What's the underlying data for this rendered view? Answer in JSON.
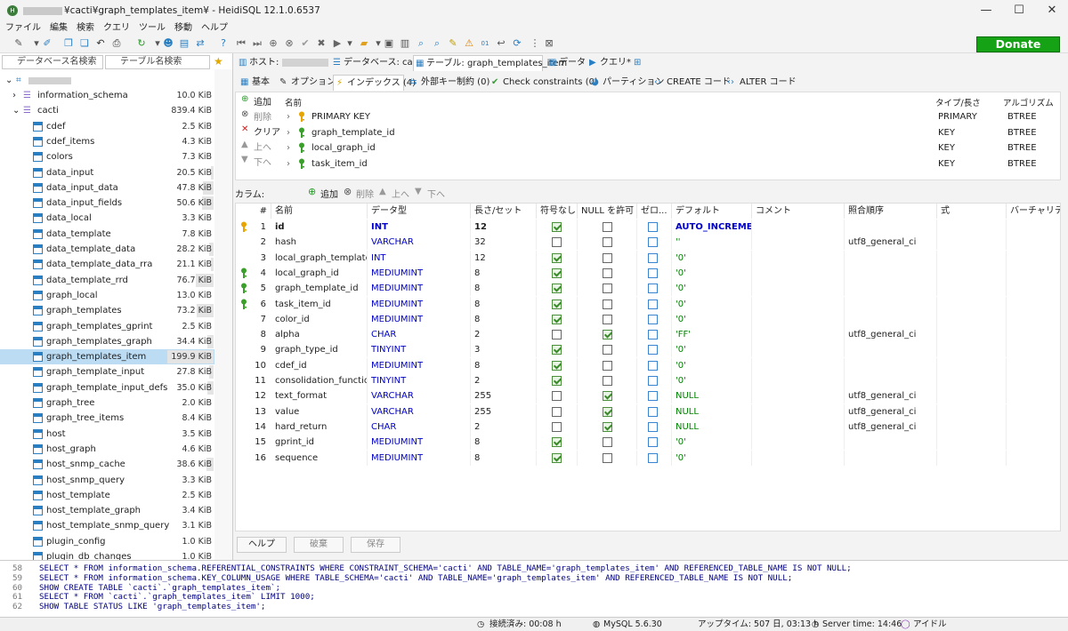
{
  "window": {
    "title": "¥cacti¥graph_templates_item¥ - HeidiSQL 12.1.0.6537",
    "controls": {
      "minimize": "—",
      "maximize": "☐",
      "close": "✕"
    }
  },
  "menu": [
    "ファイル",
    "編集",
    "検索",
    "クエリ",
    "ツール",
    "移動",
    "ヘルプ"
  ],
  "donate": "Donate",
  "left": {
    "db_filter": "データベース名検索",
    "table_filter": "テーブル名検索",
    "tree": [
      {
        "name": "information_schema",
        "size": "10.0 KiB",
        "level": 1,
        "bar": 0
      },
      {
        "name": "cacti",
        "size": "839.4 KiB",
        "level": 1,
        "bar": 0
      },
      {
        "name": "cdef",
        "size": "2.5 KiB",
        "bar": 0
      },
      {
        "name": "cdef_items",
        "size": "4.3 KiB",
        "bar": 0
      },
      {
        "name": "colors",
        "size": "7.3 KiB",
        "bar": 0
      },
      {
        "name": "data_input",
        "size": "20.5 KiB",
        "bar": 0.05
      },
      {
        "name": "data_input_data",
        "size": "47.8 KiB",
        "bar": 0.24
      },
      {
        "name": "data_input_fields",
        "size": "50.6 KiB",
        "bar": 0.25
      },
      {
        "name": "data_local",
        "size": "3.3 KiB",
        "bar": 0
      },
      {
        "name": "data_template",
        "size": "7.8 KiB",
        "bar": 0
      },
      {
        "name": "data_template_data",
        "size": "28.2 KiB",
        "bar": 0.1
      },
      {
        "name": "data_template_data_rra",
        "size": "21.1 KiB",
        "bar": 0.05
      },
      {
        "name": "data_template_rrd",
        "size": "76.7 KiB",
        "bar": 0.38
      },
      {
        "name": "graph_local",
        "size": "13.0 KiB",
        "bar": 0
      },
      {
        "name": "graph_templates",
        "size": "73.2 KiB",
        "bar": 0.36
      },
      {
        "name": "graph_templates_gprint",
        "size": "2.5 KiB",
        "bar": 0
      },
      {
        "name": "graph_templates_graph",
        "size": "34.4 KiB",
        "bar": 0.13
      },
      {
        "name": "graph_templates_item",
        "size": "199.9 KiB",
        "bar": 1,
        "selected": true
      },
      {
        "name": "graph_template_input",
        "size": "27.8 KiB",
        "bar": 0.1
      },
      {
        "name": "graph_template_input_defs",
        "size": "35.0 KiB",
        "bar": 0.13
      },
      {
        "name": "graph_tree",
        "size": "2.0 KiB",
        "bar": 0
      },
      {
        "name": "graph_tree_items",
        "size": "8.4 KiB",
        "bar": 0
      },
      {
        "name": "host",
        "size": "3.5 KiB",
        "bar": 0
      },
      {
        "name": "host_graph",
        "size": "4.6 KiB",
        "bar": 0
      },
      {
        "name": "host_snmp_cache",
        "size": "38.6 KiB",
        "bar": 0.15
      },
      {
        "name": "host_snmp_query",
        "size": "3.3 KiB",
        "bar": 0
      },
      {
        "name": "host_template",
        "size": "2.5 KiB",
        "bar": 0
      },
      {
        "name": "host_template_graph",
        "size": "3.4 KiB",
        "bar": 0
      },
      {
        "name": "host_template_snmp_query",
        "size": "3.1 KiB",
        "bar": 0
      },
      {
        "name": "plugin_config",
        "size": "1.0 KiB",
        "bar": 0
      },
      {
        "name": "plugin_db_changes",
        "size": "1.0 KiB",
        "bar": 0
      }
    ]
  },
  "tabs": {
    "host": "ホスト:",
    "database": "データベース: cacti",
    "table": "テーブル: graph_templates_item",
    "data": "データ",
    "query": "クエリ*"
  },
  "subtabs": [
    "基本",
    "オプション",
    "インデックス (4)",
    "外部キー制約 (0)",
    "Check constraints (0)",
    "パーティション",
    "CREATE コード",
    "ALTER コード"
  ],
  "index": {
    "buttons": {
      "add": "追加",
      "remove": "削除",
      "clear": "クリア",
      "up": "上へ",
      "down": "下へ"
    },
    "headers": {
      "name": "名前",
      "type": "タイプ/長さ",
      "algo": "アルゴリズム"
    },
    "rows": [
      {
        "name": "PRIMARY KEY",
        "type": "PRIMARY",
        "algo": "BTREE",
        "key": "primary"
      },
      {
        "name": "graph_template_id",
        "type": "KEY",
        "algo": "BTREE",
        "key": "key"
      },
      {
        "name": "local_graph_id",
        "type": "KEY",
        "algo": "BTREE",
        "key": "key"
      },
      {
        "name": "task_item_id",
        "type": "KEY",
        "algo": "BTREE",
        "key": "key"
      }
    ]
  },
  "columns_bar": {
    "label": "カラム:",
    "add": "追加",
    "remove": "削除",
    "up": "上へ",
    "down": "下へ"
  },
  "grid": {
    "headers": [
      "#",
      "名前",
      "データ型",
      "長さ/セット",
      "符号なし",
      "NULL を許可",
      "ゼロ...",
      "デフォルト",
      "コメント",
      "照合順序",
      "式",
      "バーチャリティ"
    ],
    "rows": [
      {
        "n": "1",
        "name": "id",
        "type": "INT",
        "len": "12",
        "unsigned": true,
        "null": false,
        "zero": false,
        "def": "AUTO_INCREME...",
        "coll": "",
        "key": "primary",
        "defstyle": "blue"
      },
      {
        "n": "2",
        "name": "hash",
        "type": "VARCHAR",
        "len": "32",
        "unsigned": false,
        "null": false,
        "zero": false,
        "def": "''",
        "coll": "utf8_general_ci",
        "key": ""
      },
      {
        "n": "3",
        "name": "local_graph_template...",
        "type": "INT",
        "len": "12",
        "unsigned": true,
        "null": false,
        "zero": false,
        "def": "'0'",
        "coll": "",
        "key": ""
      },
      {
        "n": "4",
        "name": "local_graph_id",
        "type": "MEDIUMINT",
        "len": "8",
        "unsigned": true,
        "null": false,
        "zero": false,
        "def": "'0'",
        "coll": "",
        "key": "key"
      },
      {
        "n": "5",
        "name": "graph_template_id",
        "type": "MEDIUMINT",
        "len": "8",
        "unsigned": true,
        "null": false,
        "zero": false,
        "def": "'0'",
        "coll": "",
        "key": "key"
      },
      {
        "n": "6",
        "name": "task_item_id",
        "type": "MEDIUMINT",
        "len": "8",
        "unsigned": true,
        "null": false,
        "zero": false,
        "def": "'0'",
        "coll": "",
        "key": "key"
      },
      {
        "n": "7",
        "name": "color_id",
        "type": "MEDIUMINT",
        "len": "8",
        "unsigned": true,
        "null": false,
        "zero": false,
        "def": "'0'",
        "coll": "",
        "key": ""
      },
      {
        "n": "8",
        "name": "alpha",
        "type": "CHAR",
        "len": "2",
        "unsigned": false,
        "null": true,
        "zero": false,
        "def": "'FF'",
        "coll": "utf8_general_ci",
        "key": ""
      },
      {
        "n": "9",
        "name": "graph_type_id",
        "type": "TINYINT",
        "len": "3",
        "unsigned": true,
        "null": false,
        "zero": false,
        "def": "'0'",
        "coll": "",
        "key": ""
      },
      {
        "n": "10",
        "name": "cdef_id",
        "type": "MEDIUMINT",
        "len": "8",
        "unsigned": true,
        "null": false,
        "zero": false,
        "def": "'0'",
        "coll": "",
        "key": ""
      },
      {
        "n": "11",
        "name": "consolidation_functio...",
        "type": "TINYINT",
        "len": "2",
        "unsigned": true,
        "null": false,
        "zero": false,
        "def": "'0'",
        "coll": "",
        "key": ""
      },
      {
        "n": "12",
        "name": "text_format",
        "type": "VARCHAR",
        "len": "255",
        "unsigned": false,
        "null": true,
        "zero": false,
        "def": "NULL",
        "coll": "utf8_general_ci",
        "key": ""
      },
      {
        "n": "13",
        "name": "value",
        "type": "VARCHAR",
        "len": "255",
        "unsigned": false,
        "null": true,
        "zero": false,
        "def": "NULL",
        "coll": "utf8_general_ci",
        "key": ""
      },
      {
        "n": "14",
        "name": "hard_return",
        "type": "CHAR",
        "len": "2",
        "unsigned": false,
        "null": true,
        "zero": false,
        "def": "NULL",
        "coll": "utf8_general_ci",
        "key": ""
      },
      {
        "n": "15",
        "name": "gprint_id",
        "type": "MEDIUMINT",
        "len": "8",
        "unsigned": true,
        "null": false,
        "zero": false,
        "def": "'0'",
        "coll": "",
        "key": ""
      },
      {
        "n": "16",
        "name": "sequence",
        "type": "MEDIUMINT",
        "len": "8",
        "unsigned": true,
        "null": false,
        "zero": false,
        "def": "'0'",
        "coll": "",
        "key": ""
      }
    ]
  },
  "bottom_buttons": {
    "help": "ヘルプ",
    "discard": "破棄",
    "save": "保存"
  },
  "sql_log": [
    {
      "n": "58",
      "text": "SELECT * FROM information_schema.REFERENTIAL_CONSTRAINTS WHERE   CONSTRAINT_SCHEMA='cacti'   AND TABLE_NAME='graph_templates_item'   AND REFERENCED_TABLE_NAME IS NOT NULL;"
    },
    {
      "n": "59",
      "text": "SELECT * FROM information_schema.KEY_COLUMN_USAGE WHERE   TABLE_SCHEMA='cacti'   AND TABLE_NAME='graph_templates_item'   AND REFERENCED_TABLE_NAME IS NOT NULL;"
    },
    {
      "n": "60",
      "text": "SHOW CREATE TABLE `cacti`.`graph_templates_item`;"
    },
    {
      "n": "61",
      "text": "SELECT * FROM `cacti`.`graph_templates_item` LIMIT 1000;"
    },
    {
      "n": "62",
      "text": "SHOW TABLE STATUS LIKE 'graph_templates_item';"
    }
  ],
  "status": {
    "connected": "接続済み: 00:08 h",
    "server": "MySQL 5.6.30",
    "uptime": "アップタイム: 507 日, 03:13 h",
    "server_time": "Server time: 14:46",
    "state": "アイドル"
  }
}
